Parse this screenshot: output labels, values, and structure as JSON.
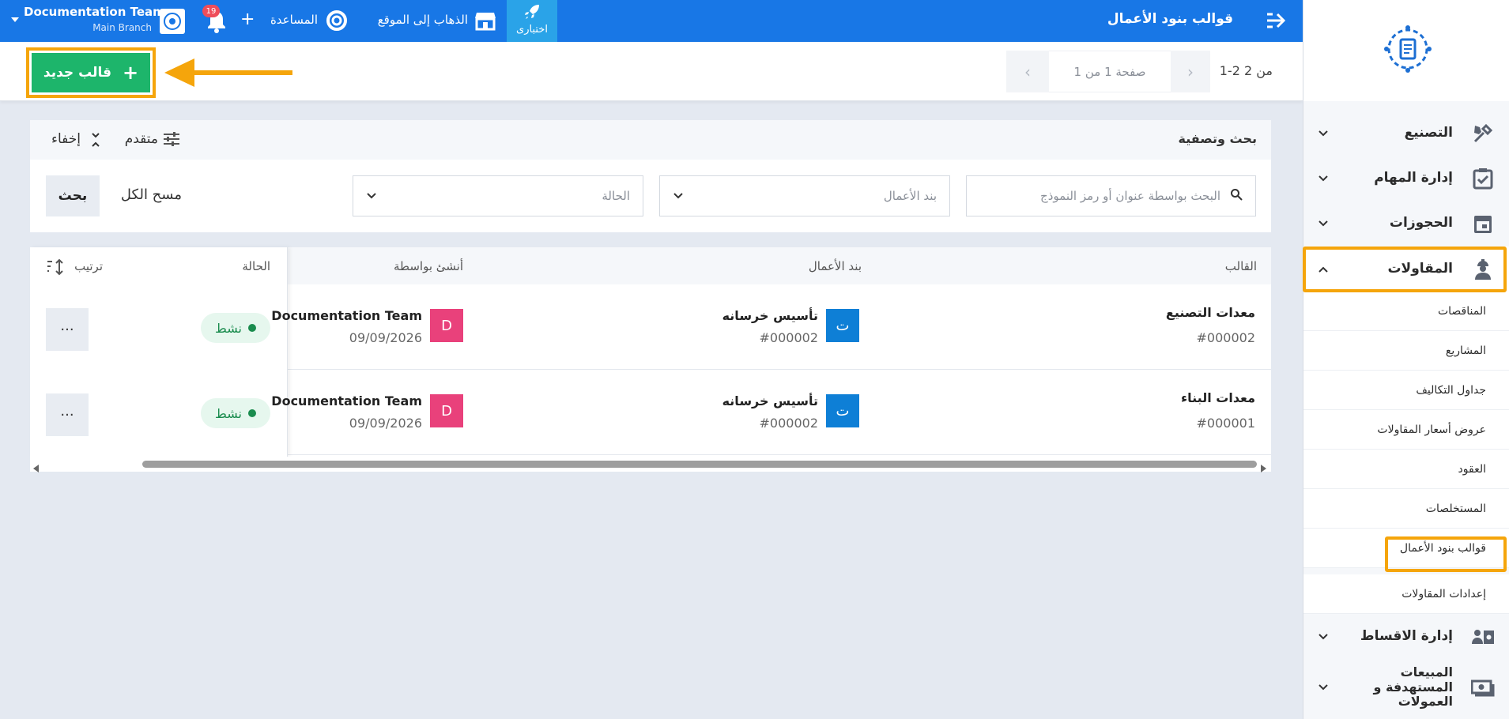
{
  "topbar": {
    "page_title": "قوالب بنود الأعمال",
    "beta_label": "اختبارى",
    "visit_site": "الذهاب إلى الموقع",
    "help": "المساعدة",
    "notification_count": "19",
    "account_name": "Documentation Team",
    "branch_name": "Main Branch"
  },
  "actions": {
    "new_template": "قالب جديد",
    "pagination_summary": "1-2 من 2",
    "page_label": "صفحة 1 من 1"
  },
  "filter": {
    "title": "بحث وتصفية",
    "advanced": "متقدم",
    "hide": "إخفاء",
    "search_placeholder": "البحث بواسطة عنوان أو رمز النموذج",
    "work_item_placeholder": "بند الأعمال",
    "status_placeholder": "الحالة",
    "clear_all": "مسح الكل",
    "search_button": "بحث"
  },
  "table": {
    "headers": {
      "template": "القالب",
      "work_item": "بند الأعمال",
      "created_by": "أنشئ بواسطة",
      "status": "الحالة",
      "sort": "ترتيب"
    },
    "rows": [
      {
        "template_name": "معدات التصنيع",
        "template_code": "#000002",
        "work_item_initial": "ت",
        "work_item_name": "تأسيس خرسانه",
        "work_item_code": "#000002",
        "creator_initial": "D",
        "creator_name": "Documentation Team",
        "created_date": "09/09/2026",
        "status": "نشط",
        "more": "···"
      },
      {
        "template_name": "معدات البناء",
        "template_code": "#000001",
        "work_item_initial": "ت",
        "work_item_name": "تأسيس خرسانه",
        "work_item_code": "#000002",
        "creator_initial": "D",
        "creator_name": "Documentation Team",
        "created_date": "09/09/2026",
        "status": "نشط",
        "more": "···"
      }
    ]
  },
  "sidebar": {
    "items": [
      {
        "label": "التصنيع",
        "icon": "tools-icon"
      },
      {
        "label": "إدارة المهام",
        "icon": "task-check-icon"
      },
      {
        "label": "الحجوزات",
        "icon": "calendar-icon"
      },
      {
        "label": "المقاولات",
        "icon": "worker-icon"
      }
    ],
    "sub_items": [
      "المناقصات",
      "المشاريع",
      "جداول التكاليف",
      "عروض أسعار المقاولات",
      "العقود",
      "المستخلصات",
      "قوالب بنود الأعمال",
      "إعدادات المقاولات"
    ],
    "bottom_items": [
      {
        "label": "إدارة الاقساط",
        "icon": "installments-icon"
      },
      {
        "label": "المبيعات المستهدفة و العمولات",
        "icon": "money-icon"
      }
    ]
  },
  "colors": {
    "primary": "#1877e6",
    "success": "#1db56b",
    "highlight": "#f5a50b",
    "badge_blue": "#0e7fd6",
    "badge_pink": "#e9417b"
  }
}
